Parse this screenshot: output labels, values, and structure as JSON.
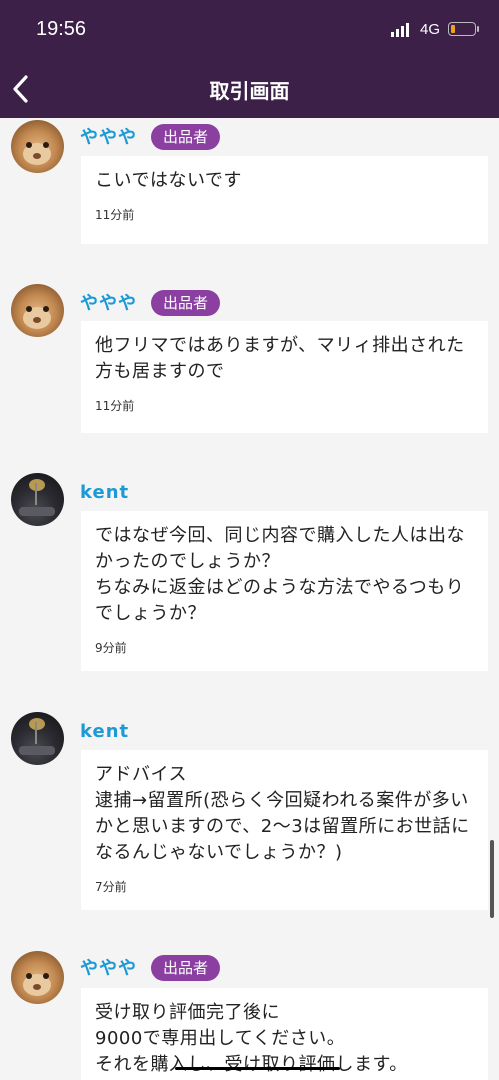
{
  "status_bar": {
    "time": "19:56",
    "network": "4G",
    "battery_level": 0.2
  },
  "nav": {
    "title": "取引画面",
    "back_icon": "chevron-left-icon"
  },
  "messages": [
    {
      "user": "ややや",
      "badge": "出品者",
      "avatar": "guinea-pig-avatar",
      "text": "こいではないです",
      "time": "11分前"
    },
    {
      "user": "ややや",
      "badge": "出品者",
      "avatar": "guinea-pig-avatar",
      "text": "他フリマではありますが、マリィ排出された方も居ますので",
      "time": "11分前"
    },
    {
      "user": "kent",
      "badge": "",
      "avatar": "night-car-avatar",
      "text": "ではなぜ今回、同じ内容で購入した人は出なかったのでしょうか？\nちなみに返金はどのような方法でやるつもりでしょうか？",
      "time": "9分前"
    },
    {
      "user": "kent",
      "badge": "",
      "avatar": "night-car-avatar",
      "text": "アドバイス\n逮捕→留置所(恐らく今回疑われる案件が多いかと思いますので、2〜3は留置所にお世話になるんじゃないでしょうか？)",
      "time": "7分前"
    },
    {
      "user": "ややや",
      "badge": "出品者",
      "avatar": "guinea-pig-avatar",
      "text": "受け取り評価完了後に\n9000で専用出してください。\nそれを購入し、受け取り評価します。",
      "time": ""
    }
  ],
  "colors": {
    "header": "#3d2048",
    "name": "#1d9ad6",
    "badge": "#8a3fa1",
    "background": "#f4f4f5"
  }
}
